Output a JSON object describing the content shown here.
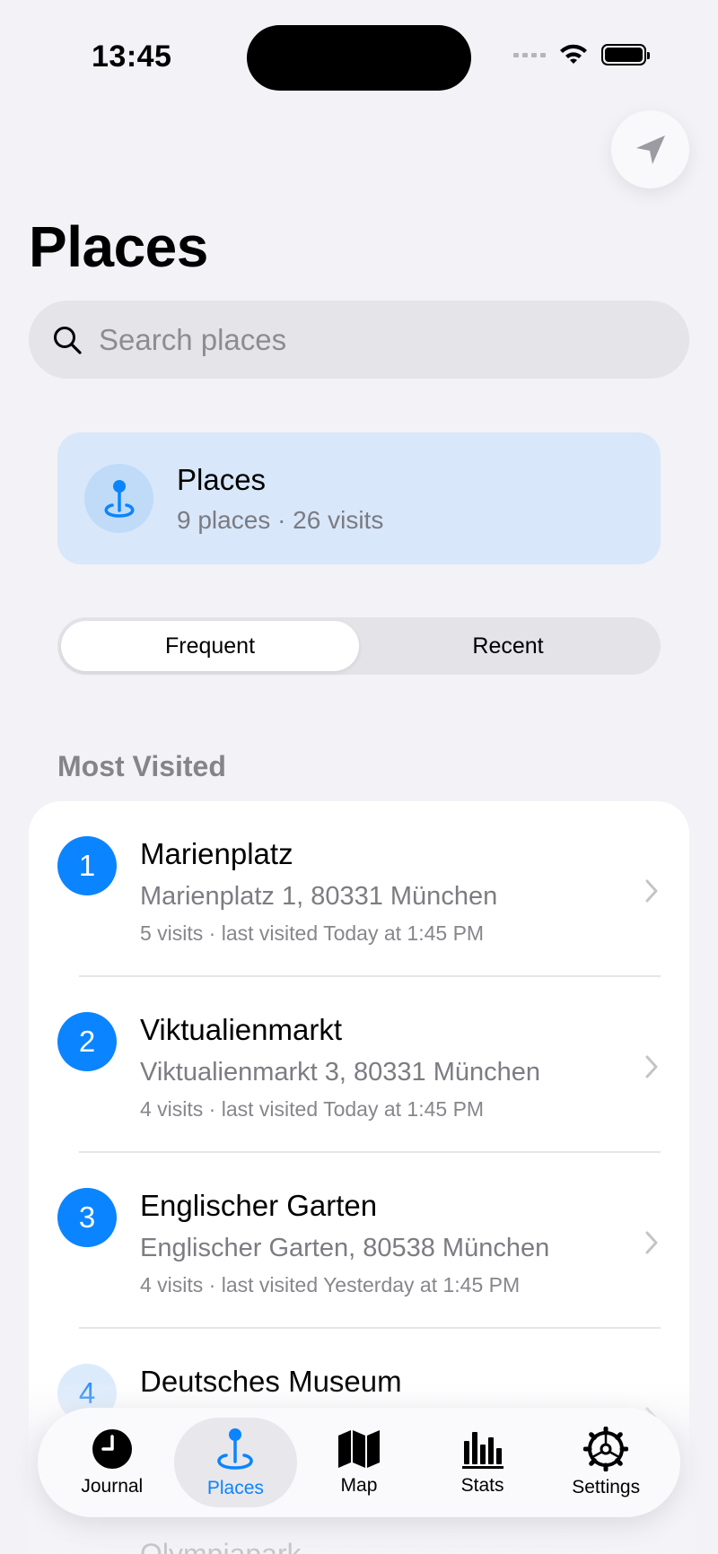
{
  "status_bar": {
    "time": "13:45"
  },
  "header": {
    "title": "Places"
  },
  "search": {
    "placeholder": "Search places"
  },
  "summary": {
    "title": "Places",
    "subtitle": "9 places · 26 visits"
  },
  "segmented": {
    "options": [
      "Frequent",
      "Recent"
    ],
    "selected": "Frequent"
  },
  "section": {
    "label": "Most Visited"
  },
  "places": [
    {
      "rank": "1",
      "name": "Marienplatz",
      "address": "Marienplatz 1, 80331 München",
      "meta": "5 visits · last visited Today at 1:45 PM"
    },
    {
      "rank": "2",
      "name": "Viktualienmarkt",
      "address": "Viktualienmarkt 3, 80331 München",
      "meta": "4 visits · last visited Today at 1:45 PM"
    },
    {
      "rank": "3",
      "name": "Englischer Garten",
      "address": "Englischer Garten, 80538 München",
      "meta": "4 visits · last visited Yesterday at 1:45 PM"
    },
    {
      "rank": "4",
      "name": "Deutsches Museum",
      "address": "",
      "meta": ""
    },
    {
      "rank": "",
      "name": "Olympiapark",
      "address": "",
      "meta": ""
    }
  ],
  "tabbar": {
    "tabs": [
      {
        "label": "Journal",
        "icon": "clock-icon"
      },
      {
        "label": "Places",
        "icon": "pin-icon"
      },
      {
        "label": "Map",
        "icon": "map-icon"
      },
      {
        "label": "Stats",
        "icon": "bar-chart-icon"
      },
      {
        "label": "Settings",
        "icon": "gear-icon"
      }
    ],
    "selected": "Places"
  },
  "colors": {
    "accent": "#0b84ff",
    "background": "#f2f2f7",
    "summary_card": "#d8e7f9"
  }
}
